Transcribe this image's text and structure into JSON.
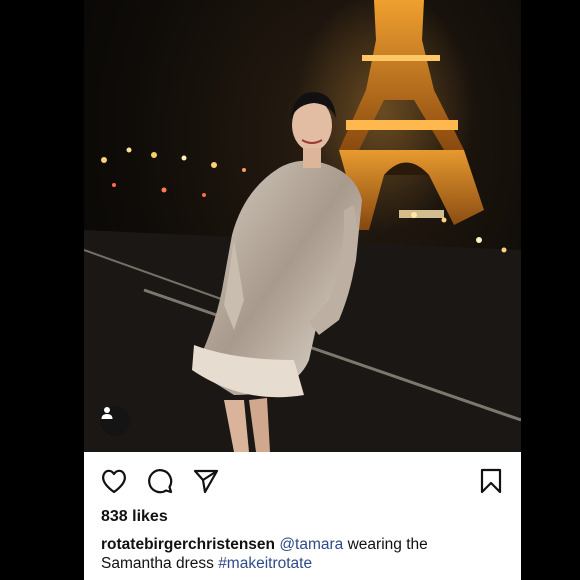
{
  "photo": {
    "alt_icon": "person-icon"
  },
  "actions": {
    "like_icon": "heart-icon",
    "comment_icon": "comment-icon",
    "share_icon": "send-icon",
    "save_icon": "bookmark-icon"
  },
  "likes_text": "838 likes",
  "caption": {
    "username": "rotatebirgerchristensen",
    "mention": "@tamara",
    "text_1": "wearing the",
    "text_2": "Samantha dress",
    "hashtag": "#makeitrotate"
  },
  "colors": {
    "link": "#2f4b8a",
    "background": "#000000",
    "card": "#ffffff"
  }
}
